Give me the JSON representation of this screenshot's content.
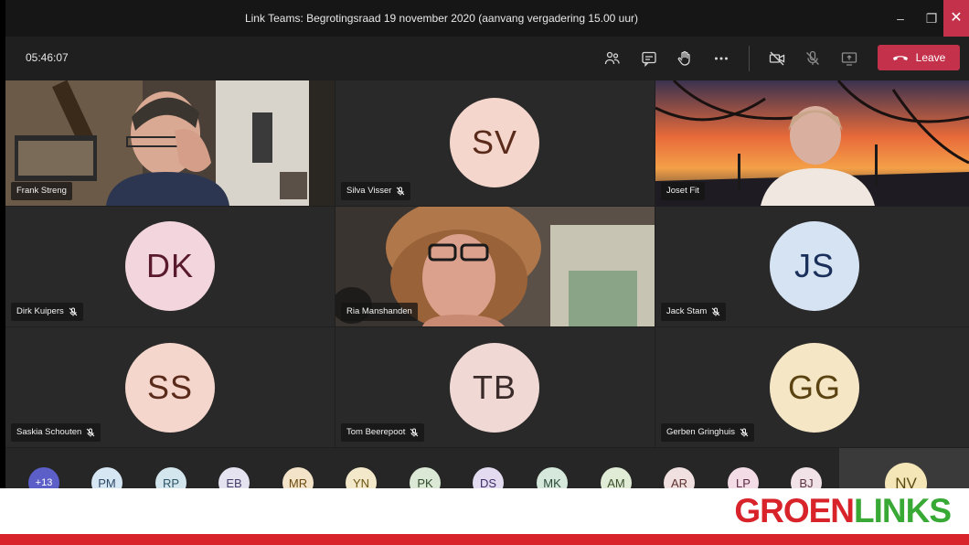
{
  "window": {
    "title": "Link Teams: Begrotingsraad 19 november 2020 (aanvang vergadering 15.00 uur)",
    "minimize": "–",
    "maximize": "❐",
    "close": "✕"
  },
  "toolbar": {
    "timer": "05:46:07",
    "icons": [
      "participants-icon",
      "chat-icon",
      "raise-hand-icon",
      "more-icon",
      "camera-off-icon",
      "mic-off-icon",
      "share-screen-icon"
    ],
    "leave_label": "Leave",
    "leave_color": "#c4314b"
  },
  "tiles": [
    {
      "name": "Frank Streng",
      "type": "video",
      "muted": false
    },
    {
      "name": "Silva Visser",
      "type": "avatar",
      "initials": "SV",
      "bg": "#f4d6cc",
      "fg": "#5a2a1a",
      "muted": true
    },
    {
      "name": "Joset Fit",
      "type": "video",
      "muted": false
    },
    {
      "name": "Dirk Kuipers",
      "type": "avatar",
      "initials": "DK",
      "bg": "#f3d6dd",
      "fg": "#5a1a2e",
      "muted": true
    },
    {
      "name": "Ria Manshanden",
      "type": "video",
      "muted": false
    },
    {
      "name": "Jack Stam",
      "type": "avatar",
      "initials": "JS",
      "bg": "#d6e3f3",
      "fg": "#1a2f5a",
      "muted": true
    },
    {
      "name": "Saskia Schouten",
      "type": "avatar",
      "initials": "SS",
      "bg": "#f4d6cc",
      "fg": "#5a2a1a",
      "muted": true
    },
    {
      "name": "Tom Beerepoot",
      "type": "avatar",
      "initials": "TB",
      "bg": "#f0d9d4",
      "fg": "#3a2a2a",
      "muted": true
    },
    {
      "name": "Gerben Gringhuis",
      "type": "avatar",
      "initials": "GG",
      "bg": "#f5e6c6",
      "fg": "#5a4310",
      "muted": true
    }
  ],
  "strip": [
    {
      "label": "+13",
      "bg": "#5b5fc7",
      "fg": "#ffffff"
    },
    {
      "label": "PM",
      "bg": "#d6e6f2",
      "fg": "#2d4a66"
    },
    {
      "label": "RP",
      "bg": "#d3e6ee",
      "fg": "#2d5566"
    },
    {
      "label": "EB",
      "bg": "#e6e3f0",
      "fg": "#45406a"
    },
    {
      "label": "MR",
      "bg": "#f3e4c9",
      "fg": "#6a4a12"
    },
    {
      "label": "YN",
      "bg": "#f3e8c9",
      "fg": "#6a5512"
    },
    {
      "label": "PK",
      "bg": "#dbe8d6",
      "fg": "#2e4a2a"
    },
    {
      "label": "DS",
      "bg": "#e3dcf0",
      "fg": "#3f2d66"
    },
    {
      "label": "MK",
      "bg": "#d6e8dc",
      "fg": "#2a4a35"
    },
    {
      "label": "AM",
      "bg": "#e0ecd6",
      "fg": "#3a4f2a"
    },
    {
      "label": "AR",
      "bg": "#f0e0e0",
      "fg": "#5a2f2f"
    },
    {
      "label": "LP",
      "bg": "#f3dce6",
      "fg": "#5a2a44"
    },
    {
      "label": "BJ",
      "bg": "#f0e2e6",
      "fg": "#5a3440"
    }
  ],
  "strip_featured": {
    "label": "NV",
    "bg": "#f5e6b8",
    "fg": "#5a4a12"
  },
  "logo": {
    "part1": "GROEN",
    "part2": "LINKS",
    "red": "#d8232a",
    "green": "#39a935"
  }
}
